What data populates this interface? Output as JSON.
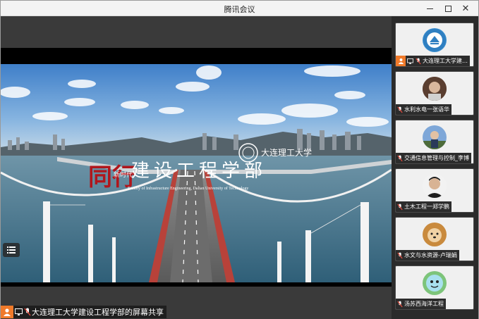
{
  "window": {
    "title": "腾讯会议"
  },
  "share": {
    "label": "大连理工大学建设工程学部的屏幕共享"
  },
  "video": {
    "logo_calligraphy": "同行",
    "logo_small": "新时代",
    "heading": "建设工程学部",
    "subtitle": "Faculty of Infrastructure Engineering, Dalian University of Technology",
    "university_name": "大连理工大学"
  },
  "participants": [
    {
      "name": "大连理工大学建…",
      "kind": "logo"
    },
    {
      "name": "水利水电一张语华",
      "kind": "photo"
    },
    {
      "name": "交通信息管理与控制_李博",
      "kind": "photo"
    },
    {
      "name": "土木工程一郑学鹏",
      "kind": "photo"
    },
    {
      "name": "水文与水资源-卢瑞娟",
      "kind": "photo"
    },
    {
      "name": "汤苏西海洋工程",
      "kind": "photo"
    }
  ],
  "colors": {
    "accent": "#f07a2a",
    "title_red": "#b0161c"
  }
}
